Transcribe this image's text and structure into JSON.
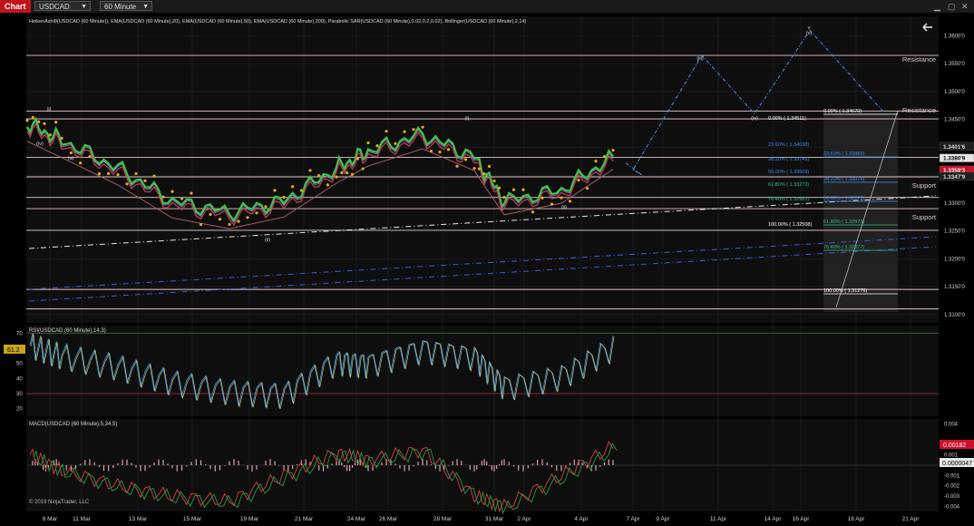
{
  "toolbar": {
    "tab_label": "Chart",
    "instrument": "USDCAD",
    "interval": "60 Minute"
  },
  "price_panel": {
    "indicator_label": "HeikenAshi8(USDCAD (60 Minute)), EMA(USDCAD (60 Minute),20), EMA(USDCAD (60 Minute),50), EMA(USDCAD (60 Minute),200), Parabolic SAR(USDCAD (60 Minute),0.02,0.2,0.02), Bollinger(USDCAD (60 Minute),2,14)",
    "y_ticks": [
      "1.3600'0",
      "1.3550'0",
      "1.3500'0",
      "1.3450'0",
      "1.3400'0",
      "1.3350'0",
      "1.3300'0",
      "1.3250'0",
      "1.3200'0",
      "1.3150'0",
      "1.3100'0"
    ],
    "y_tick_values": [
      1.36,
      1.355,
      1.35,
      1.345,
      1.34,
      1.335,
      1.33,
      1.325,
      1.32,
      1.315,
      1.31
    ],
    "price_labels": [
      {
        "text": "1.3401'6",
        "value": 1.34016,
        "color": "#1e1e1e",
        "fg": "#dddddd"
      },
      {
        "text": "1.3380'9",
        "value": 1.33809,
        "color": "#e6e6e6",
        "fg": "#000000"
      },
      {
        "text": "1.3359'3",
        "value": 1.33593,
        "color": "#d0102a",
        "fg": "#ffffff"
      },
      {
        "text": "1.3347'9",
        "value": 1.33479,
        "color": "#1e1e1e",
        "fg": "#dddddd"
      }
    ],
    "zone_labels": [
      "Resistance",
      "Resistance",
      "Support",
      "Support"
    ],
    "fib_left": [
      {
        "text": "0.00% ( 1.34511)",
        "color": "#ffffff"
      },
      {
        "text": "23.60% ( 1.34038)",
        "color": "#3d8ff0"
      },
      {
        "text": "38.20% ( 1.33745)",
        "color": "#3d8ff0"
      },
      {
        "text": "50.00% ( 1.33509)",
        "color": "#3d8ff0"
      },
      {
        "text": "61.80% ( 1.33273)",
        "color": "#2fbf8f"
      },
      {
        "text": "76.40% ( 1.32981)",
        "color": "#2fbf8f"
      },
      {
        "text": "100.00% ( 1.32508)",
        "color": "#ffffff"
      }
    ],
    "fib_right": [
      {
        "text": "0.00% ( 1.34670)",
        "color": "#ffffff"
      },
      {
        "text": "23.60% ( 1.33889)",
        "color": "#3d8ff0"
      },
      {
        "text": "38.20% ( 1.33374)",
        "color": "#3d8ff0"
      },
      {
        "text": "50.00% ( 1.32973)",
        "color": "#3d8ff0"
      },
      {
        "text": "61.80% ( 1.32573)",
        "color": "#2fbf8f"
      },
      {
        "text": "76.40% ( 1.32077)",
        "color": "#2fbf8f"
      },
      {
        "text": "100.00% ( 1.31276)",
        "color": "#ffffff"
      }
    ],
    "wave_labels": [
      "(iv)",
      "(a)",
      "(i)",
      "(ii)",
      "(i)",
      "(ii)",
      "(iii)",
      "(iv)",
      "(v)",
      "v"
    ]
  },
  "rsi_panel": {
    "label": "RSI(USDCAD (60 Minute),14,3)",
    "y_ticks": [
      "70",
      "60",
      "50",
      "40",
      "30",
      "20"
    ],
    "current": "61.2"
  },
  "macd_panel": {
    "label": "MACD(USDCAD (60 Minute),5,34,5)",
    "y_ticks": [
      "0.004",
      "0.002",
      "0.001",
      "-0.001",
      "-0.002",
      "-0.003",
      "-0.004"
    ],
    "current_main": "0.00182",
    "current_signal": "0.0000047"
  },
  "x_ticks": [
    "8 Mar",
    "11 Mar",
    "13 Mar",
    "15 Mar",
    "19 Mar",
    "21 Mar",
    "24 Mar",
    "26 Mar",
    "28 Mar",
    "31 Mar",
    "2 Apr",
    "4 Apr",
    "7 Apr",
    "9 Apr",
    "11 Apr",
    "14 Apr",
    "16 Apr",
    "18 Apr",
    "21 Apr"
  ],
  "copyright": "© 2019 NinjaTrader, LLC",
  "chart_data": {
    "type": "line",
    "title": "",
    "xlabel": "",
    "ylabel": "",
    "ylim": [
      1.3085,
      1.3635
    ],
    "x": [
      "8 Mar",
      "11 Mar",
      "13 Mar",
      "15 Mar",
      "19 Mar",
      "21 Mar",
      "24 Mar",
      "26 Mar",
      "28 Mar",
      "31 Mar",
      "2 Apr",
      "4 Apr",
      "7 Apr"
    ],
    "series": [
      {
        "values": [
          1.344,
          1.341,
          1.336,
          1.33,
          1.328,
          1.33,
          1.336,
          1.339,
          1.342,
          1.338,
          1.33,
          1.332,
          1.338
        ]
      }
    ],
    "projection": {
      "x": [
        "7 Apr",
        "11 Apr",
        "14 Apr",
        "16 Apr",
        "19 Apr"
      ],
      "values": [
        1.336,
        1.3565,
        1.346,
        1.361,
        1.3462
      ]
    },
    "horizontal_levels": [
      1.3565,
      1.3465,
      1.3451,
      1.3382,
      1.3347,
      1.331,
      1.329,
      1.3251,
      1.3145,
      1.311
    ],
    "rsi": [
      62,
      55,
      48,
      38,
      32,
      30,
      52,
      50,
      60,
      55,
      35,
      42,
      61.2
    ],
    "rsi_levels": [
      70,
      30
    ],
    "macd_ylim": [
      -0.0045,
      0.0045
    ],
    "macd": [
      0.001,
      -0.0005,
      -0.002,
      -0.003,
      -0.0035,
      -0.001,
      0.0012,
      0.0005,
      0.0015,
      -0.003,
      -0.004,
      -0.001,
      0.00182
    ]
  }
}
